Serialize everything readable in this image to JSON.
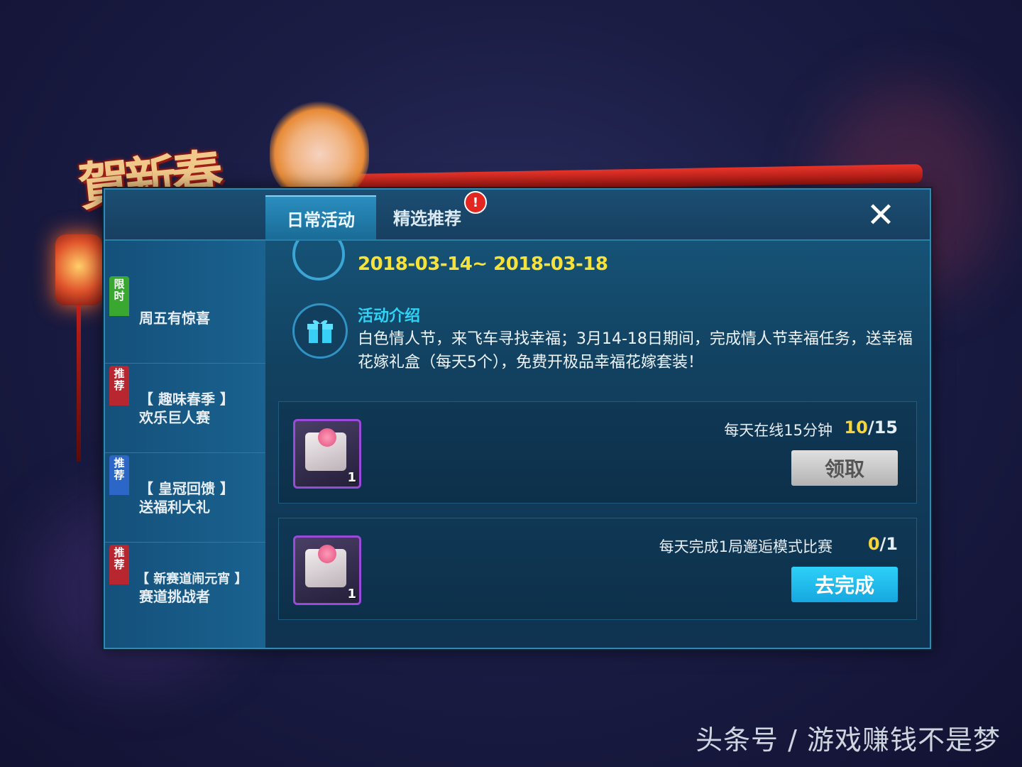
{
  "festive": {
    "logo_text": "賀新春"
  },
  "tabs": [
    {
      "label": "日常活动"
    },
    {
      "label": "精选推荐"
    }
  ],
  "badge": "!",
  "close_label": "✕",
  "sidebar": {
    "items": [
      {
        "tag": "限时",
        "tag_color": "#3aa830",
        "title": "周五有惊喜",
        "sub": ""
      },
      {
        "tag": "推荐",
        "tag_color": "#b8262f",
        "title": "【 趣味春季 】",
        "sub": "欢乐巨人赛"
      },
      {
        "tag": "推荐",
        "tag_color": "#2c66c7",
        "title": "【 皇冠回馈 】",
        "sub": "送福利大礼"
      },
      {
        "tag": "推荐",
        "tag_color": "#b8262f",
        "title": "【 新赛道闹元宵 】",
        "sub": "赛道挑战者"
      }
    ]
  },
  "event": {
    "date_range": "2018-03-14~ 2018-03-18",
    "intro_title": "活动介绍",
    "intro_text": "白色情人节，来飞车寻找幸福；3月14-18日期间，完成情人节幸福任务，送幸福花嫁礼盒（每天5个），免费开极品幸福花嫁套装！"
  },
  "tasks": [
    {
      "desc": "每天在线15分钟",
      "progress_current": "10",
      "progress_sep": "/",
      "progress_total": "15",
      "item_count": "1",
      "button": "领取",
      "button_state": "disabled"
    },
    {
      "desc": "每天完成1局邂逅模式比赛",
      "progress_current": "0",
      "progress_sep": "/",
      "progress_total": "1",
      "item_count": "1",
      "button": "去完成",
      "button_state": "active"
    }
  ],
  "watermark": "头条号 / 游戏赚钱不是梦",
  "colors": {
    "accent_yellow": "#f7e23a",
    "accent_cyan": "#2fd1f4",
    "button_blue": "#16a7e0",
    "panel_blue": "#175a7f"
  }
}
